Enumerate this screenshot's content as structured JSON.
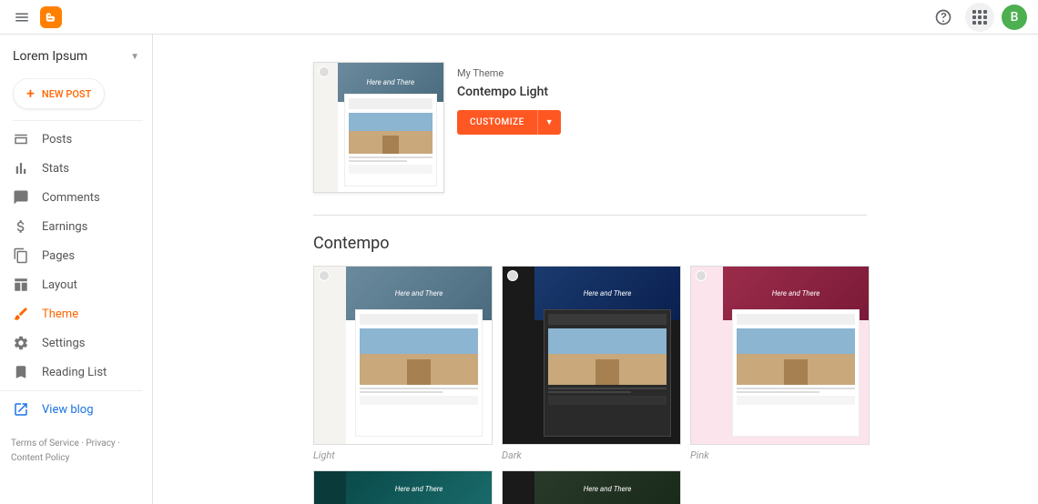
{
  "header": {
    "avatar_initial": "B"
  },
  "sidebar": {
    "blog_name": "Lorem Ipsum",
    "new_post_label": "NEW POST",
    "nav": [
      {
        "label": "Posts",
        "icon": "posts"
      },
      {
        "label": "Stats",
        "icon": "stats"
      },
      {
        "label": "Comments",
        "icon": "comments"
      },
      {
        "label": "Earnings",
        "icon": "earnings"
      },
      {
        "label": "Pages",
        "icon": "pages"
      },
      {
        "label": "Layout",
        "icon": "layout"
      },
      {
        "label": "Theme",
        "icon": "theme",
        "active": true
      },
      {
        "label": "Settings",
        "icon": "settings"
      },
      {
        "label": "Reading List",
        "icon": "reading"
      },
      {
        "label": "View blog",
        "icon": "view"
      }
    ],
    "footer": {
      "terms": "Terms of Service",
      "privacy": "Privacy",
      "content_policy": "Content Policy"
    }
  },
  "main": {
    "my_theme": {
      "label": "My Theme",
      "name": "Contempo Light",
      "customize_label": "CUSTOMIZE"
    },
    "section_title": "Contempo",
    "preview_title": "Here and There",
    "variants": [
      {
        "caption": "Light",
        "variant": "light"
      },
      {
        "caption": "Dark",
        "variant": "dark"
      },
      {
        "caption": "Pink",
        "variant": "pink"
      },
      {
        "caption": "",
        "variant": "teal"
      },
      {
        "caption": "",
        "variant": "foliage"
      }
    ]
  }
}
